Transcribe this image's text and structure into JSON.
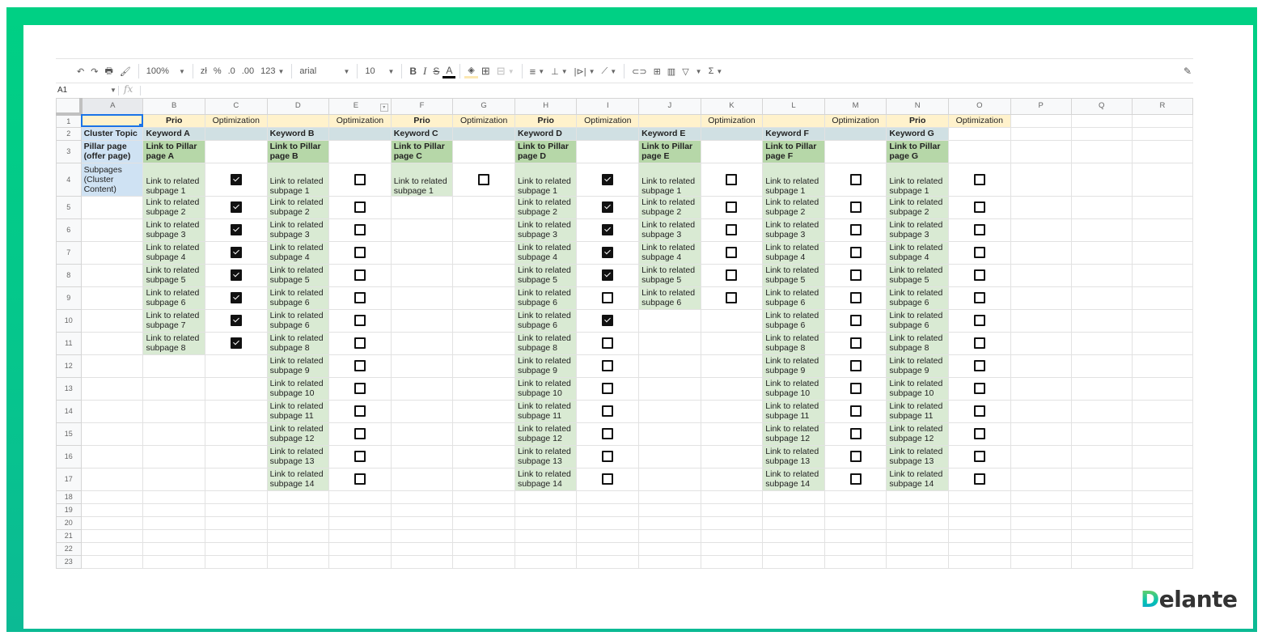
{
  "toolbar": {
    "undo": "↶",
    "redo": "↷",
    "print": "🖶",
    "paint_format": "🖌",
    "zoom": "100%",
    "currency": "zł",
    "percent": "%",
    "dec_decrease": ".0",
    "dec_increase": ".00",
    "more_formats": "123",
    "font": "arial",
    "font_size": "10",
    "bold": "B",
    "italic": "I",
    "strike": "S",
    "text_color": "A",
    "fill": "◈",
    "borders": "⊞",
    "merge": "⊟",
    "halign": "≡",
    "valign": "⊥",
    "wrap": "|⊳|",
    "rotate": "⟋",
    "link": "⊂⊃",
    "comment": "⊞",
    "chart": "▥",
    "filter": "▽",
    "functions": "Σ",
    "pen": "✎"
  },
  "formula_bar": {
    "cell_ref": "A1",
    "fx": "fx",
    "value": ""
  },
  "columns": [
    "A",
    "B",
    "C",
    "D",
    "E",
    "F",
    "G",
    "H",
    "I",
    "J",
    "K",
    "L",
    "M",
    "N",
    "O",
    "P",
    "Q",
    "R"
  ],
  "rows": {
    "r1": [
      "",
      "Prio",
      "Optimization",
      "",
      "Optimization",
      "Prio",
      "Optimization",
      "Prio",
      "Optimization",
      "",
      "Optimization",
      "",
      "Optimization",
      "Prio",
      "Optimization"
    ],
    "r2": [
      "Cluster Topic",
      "Keyword A",
      "",
      "Keyword B",
      "",
      "Keyword C",
      "",
      "Keyword D",
      "",
      "Keyword E",
      "",
      "Keyword F",
      "",
      "Keyword G"
    ],
    "r3": [
      "Pillar page (offer page)",
      "Link to Pillar page A",
      "",
      "Link to Pillar page B",
      "",
      "Link to Pillar page C",
      "",
      "Link to Pillar page D",
      "",
      "Link to Pillar page E",
      "",
      "Link to Pillar page F",
      "",
      "Link to Pillar page G"
    ],
    "r4_a": "Subpages (Cluster Content)"
  },
  "keyword_columns": [
    {
      "keyword": "Keyword A",
      "subpages": [
        "Link to related subpage 1",
        "Link to related subpage 2",
        "Link to related subpage 3",
        "Link to related subpage 4",
        "Link to related subpage 5",
        "Link to related subpage 6",
        "Link to related subpage 7",
        "Link to related subpage 8"
      ],
      "checked": [
        true,
        true,
        true,
        true,
        true,
        true,
        true,
        true
      ]
    },
    {
      "keyword": "Keyword B",
      "subpages": [
        "Link to related subpage 1",
        "Link to related subpage 2",
        "Link to related subpage 3",
        "Link to related subpage 4",
        "Link to related subpage 5",
        "Link to related subpage 6",
        "Link to related subpage 6",
        "Link to related subpage 8",
        "Link to related subpage 9",
        "Link to related subpage 10",
        "Link to related subpage 11",
        "Link to related subpage 12",
        "Link to related subpage 13",
        "Link to related subpage 14"
      ],
      "checked": [
        false,
        false,
        false,
        false,
        false,
        false,
        false,
        false,
        false,
        false,
        false,
        false,
        false,
        false
      ]
    },
    {
      "keyword": "Keyword C",
      "subpages": [
        "Link to related subpage 1"
      ],
      "checked": [
        false
      ]
    },
    {
      "keyword": "Keyword D",
      "subpages": [
        "Link to related subpage 1",
        "Link to related subpage 2",
        "Link to related subpage 3",
        "Link to related subpage 4",
        "Link to related subpage 5",
        "Link to related subpage 6",
        "Link to related subpage 6",
        "Link to related subpage 8",
        "Link to related subpage 9",
        "Link to related subpage 10",
        "Link to related subpage 11",
        "Link to related subpage 12",
        "Link to related subpage 13",
        "Link to related subpage 14"
      ],
      "checked": [
        true,
        true,
        true,
        true,
        true,
        false,
        true,
        false,
        false,
        false,
        false,
        false,
        false,
        false
      ]
    },
    {
      "keyword": "Keyword E",
      "subpages": [
        "Link to related subpage 1",
        "Link to related subpage 2",
        "Link to related subpage 3",
        "Link to related subpage 4",
        "Link to related subpage 5",
        "Link to related subpage 6"
      ],
      "checked": [
        false,
        false,
        false,
        false,
        false,
        false
      ]
    },
    {
      "keyword": "Keyword F",
      "subpages": [
        "Link to related subpage 1",
        "Link to related subpage 2",
        "Link to related subpage 3",
        "Link to related subpage 4",
        "Link to related subpage 5",
        "Link to related subpage 6",
        "Link to related subpage 6",
        "Link to related subpage 8",
        "Link to related subpage 9",
        "Link to related subpage 10",
        "Link to related subpage 11",
        "Link to related subpage 12",
        "Link to related subpage 13",
        "Link to related subpage 14"
      ],
      "checked": [
        false,
        false,
        false,
        false,
        false,
        false,
        false,
        false,
        false,
        false,
        false,
        false,
        false,
        false
      ]
    },
    {
      "keyword": "Keyword G",
      "subpages": [
        "Link to related subpage 1",
        "Link to related subpage 2",
        "Link to related subpage 3",
        "Link to related subpage 4",
        "Link to related subpage 5",
        "Link to related subpage 6",
        "Link to related subpage 6",
        "Link to related subpage 8",
        "Link to related subpage 9",
        "Link to related subpage 10",
        "Link to related subpage 11",
        "Link to related subpage 12",
        "Link to related subpage 13",
        "Link to related subpage 14"
      ],
      "checked": [
        false,
        false,
        false,
        false,
        false,
        false,
        false,
        false,
        false,
        false,
        false,
        false,
        false,
        false
      ]
    }
  ],
  "row_count": 23,
  "brand": {
    "logo_initial": "D",
    "logo_rest": "elante",
    "frame_color_top": "#00d084",
    "frame_color_bottom": "#0cba94"
  }
}
